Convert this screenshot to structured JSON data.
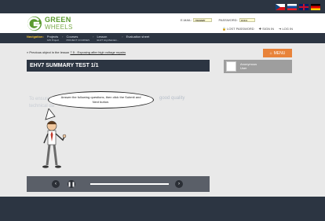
{
  "flags": [
    {
      "name": "flag-cz"
    },
    {
      "name": "flag-sk"
    },
    {
      "name": "flag-gb"
    },
    {
      "name": "flag-de"
    }
  ],
  "logo": {
    "line1": "GREEN",
    "line2": "WHEELS"
  },
  "login": {
    "email_label": "E-MAIL:",
    "email_value": "myuser",
    "password_label": "PASSWORD:",
    "password_value": "••••••",
    "lost_password": "LOST PASSWORD",
    "sign_in": "SIGN IN",
    "log_in": "LOG IN"
  },
  "nav": {
    "label": "Navigation:",
    "crumbs": [
      {
        "main": "Projects",
        "sub": "GW Project"
      },
      {
        "main": "Courses",
        "sub": "PROJECT COURSES"
      },
      {
        "main": "Lesson",
        "sub": "EHV7 Hig Maintain..."
      },
      {
        "main": "Evaluation sheet",
        "sub": ""
      }
    ]
  },
  "previous": {
    "prefix": "Previous object in the lesson",
    "link": "7.5 - Exposing after high voltage repairs"
  },
  "menu_button": "MENU",
  "test_title": "EHV7 SUMMARY TEST 1/1",
  "user": {
    "line1": "Anonymous",
    "line2": "User"
  },
  "background_text": {
    "line1": "To ensure a",
    "line2": "technical da",
    "right": "good quality"
  },
  "speech_bubble": "Answer the following questions, then click the Submit and Next button.",
  "player": {
    "progress": 1.0
  },
  "colors": {
    "dark": "#2c3542",
    "accent": "#e8833a",
    "brand_green": "#5a9a2f"
  }
}
